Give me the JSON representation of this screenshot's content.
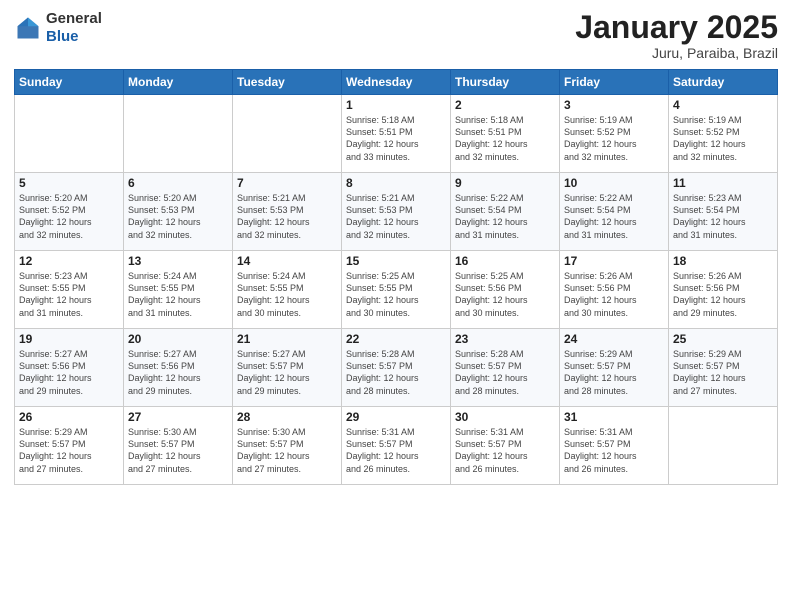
{
  "header": {
    "logo_general": "General",
    "logo_blue": "Blue",
    "month_title": "January 2025",
    "location": "Juru, Paraiba, Brazil"
  },
  "weekdays": [
    "Sunday",
    "Monday",
    "Tuesday",
    "Wednesday",
    "Thursday",
    "Friday",
    "Saturday"
  ],
  "weeks": [
    [
      {
        "day": "",
        "info": ""
      },
      {
        "day": "",
        "info": ""
      },
      {
        "day": "",
        "info": ""
      },
      {
        "day": "1",
        "info": "Sunrise: 5:18 AM\nSunset: 5:51 PM\nDaylight: 12 hours\nand 33 minutes."
      },
      {
        "day": "2",
        "info": "Sunrise: 5:18 AM\nSunset: 5:51 PM\nDaylight: 12 hours\nand 32 minutes."
      },
      {
        "day": "3",
        "info": "Sunrise: 5:19 AM\nSunset: 5:52 PM\nDaylight: 12 hours\nand 32 minutes."
      },
      {
        "day": "4",
        "info": "Sunrise: 5:19 AM\nSunset: 5:52 PM\nDaylight: 12 hours\nand 32 minutes."
      }
    ],
    [
      {
        "day": "5",
        "info": "Sunrise: 5:20 AM\nSunset: 5:52 PM\nDaylight: 12 hours\nand 32 minutes."
      },
      {
        "day": "6",
        "info": "Sunrise: 5:20 AM\nSunset: 5:53 PM\nDaylight: 12 hours\nand 32 minutes."
      },
      {
        "day": "7",
        "info": "Sunrise: 5:21 AM\nSunset: 5:53 PM\nDaylight: 12 hours\nand 32 minutes."
      },
      {
        "day": "8",
        "info": "Sunrise: 5:21 AM\nSunset: 5:53 PM\nDaylight: 12 hours\nand 32 minutes."
      },
      {
        "day": "9",
        "info": "Sunrise: 5:22 AM\nSunset: 5:54 PM\nDaylight: 12 hours\nand 31 minutes."
      },
      {
        "day": "10",
        "info": "Sunrise: 5:22 AM\nSunset: 5:54 PM\nDaylight: 12 hours\nand 31 minutes."
      },
      {
        "day": "11",
        "info": "Sunrise: 5:23 AM\nSunset: 5:54 PM\nDaylight: 12 hours\nand 31 minutes."
      }
    ],
    [
      {
        "day": "12",
        "info": "Sunrise: 5:23 AM\nSunset: 5:55 PM\nDaylight: 12 hours\nand 31 minutes."
      },
      {
        "day": "13",
        "info": "Sunrise: 5:24 AM\nSunset: 5:55 PM\nDaylight: 12 hours\nand 31 minutes."
      },
      {
        "day": "14",
        "info": "Sunrise: 5:24 AM\nSunset: 5:55 PM\nDaylight: 12 hours\nand 30 minutes."
      },
      {
        "day": "15",
        "info": "Sunrise: 5:25 AM\nSunset: 5:55 PM\nDaylight: 12 hours\nand 30 minutes."
      },
      {
        "day": "16",
        "info": "Sunrise: 5:25 AM\nSunset: 5:56 PM\nDaylight: 12 hours\nand 30 minutes."
      },
      {
        "day": "17",
        "info": "Sunrise: 5:26 AM\nSunset: 5:56 PM\nDaylight: 12 hours\nand 30 minutes."
      },
      {
        "day": "18",
        "info": "Sunrise: 5:26 AM\nSunset: 5:56 PM\nDaylight: 12 hours\nand 29 minutes."
      }
    ],
    [
      {
        "day": "19",
        "info": "Sunrise: 5:27 AM\nSunset: 5:56 PM\nDaylight: 12 hours\nand 29 minutes."
      },
      {
        "day": "20",
        "info": "Sunrise: 5:27 AM\nSunset: 5:56 PM\nDaylight: 12 hours\nand 29 minutes."
      },
      {
        "day": "21",
        "info": "Sunrise: 5:27 AM\nSunset: 5:57 PM\nDaylight: 12 hours\nand 29 minutes."
      },
      {
        "day": "22",
        "info": "Sunrise: 5:28 AM\nSunset: 5:57 PM\nDaylight: 12 hours\nand 28 minutes."
      },
      {
        "day": "23",
        "info": "Sunrise: 5:28 AM\nSunset: 5:57 PM\nDaylight: 12 hours\nand 28 minutes."
      },
      {
        "day": "24",
        "info": "Sunrise: 5:29 AM\nSunset: 5:57 PM\nDaylight: 12 hours\nand 28 minutes."
      },
      {
        "day": "25",
        "info": "Sunrise: 5:29 AM\nSunset: 5:57 PM\nDaylight: 12 hours\nand 27 minutes."
      }
    ],
    [
      {
        "day": "26",
        "info": "Sunrise: 5:29 AM\nSunset: 5:57 PM\nDaylight: 12 hours\nand 27 minutes."
      },
      {
        "day": "27",
        "info": "Sunrise: 5:30 AM\nSunset: 5:57 PM\nDaylight: 12 hours\nand 27 minutes."
      },
      {
        "day": "28",
        "info": "Sunrise: 5:30 AM\nSunset: 5:57 PM\nDaylight: 12 hours\nand 27 minutes."
      },
      {
        "day": "29",
        "info": "Sunrise: 5:31 AM\nSunset: 5:57 PM\nDaylight: 12 hours\nand 26 minutes."
      },
      {
        "day": "30",
        "info": "Sunrise: 5:31 AM\nSunset: 5:57 PM\nDaylight: 12 hours\nand 26 minutes."
      },
      {
        "day": "31",
        "info": "Sunrise: 5:31 AM\nSunset: 5:57 PM\nDaylight: 12 hours\nand 26 minutes."
      },
      {
        "day": "",
        "info": ""
      }
    ]
  ]
}
